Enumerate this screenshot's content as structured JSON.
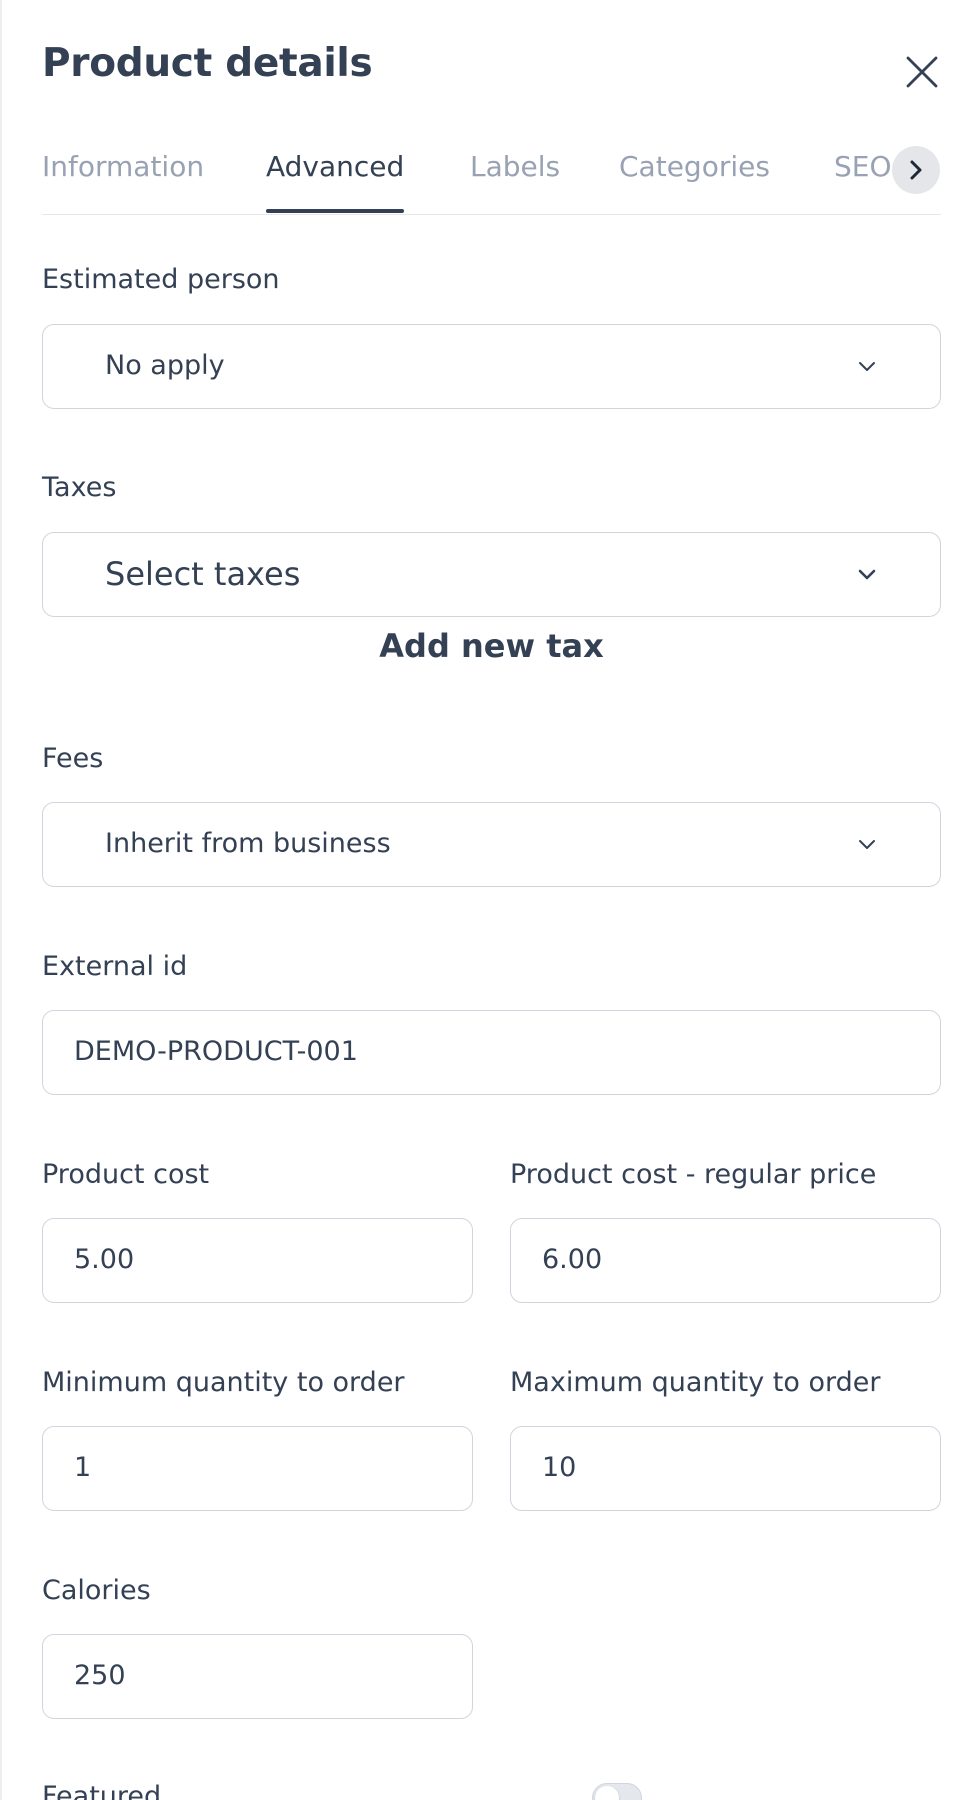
{
  "header": {
    "title": "Product details",
    "close_icon": "close-icon"
  },
  "tabs": [
    {
      "label": "Information",
      "active": false
    },
    {
      "label": "Advanced",
      "active": true
    },
    {
      "label": "Labels",
      "active": false
    },
    {
      "label": "Categories",
      "active": false
    },
    {
      "label": "SEO Options",
      "active": false
    }
  ],
  "tabs_next_icon": "chevron-right-icon",
  "form": {
    "estimated_person": {
      "label": "Estimated person",
      "value": "No apply"
    },
    "taxes": {
      "label": "Taxes",
      "placeholder": "Select taxes",
      "add_label": "Add new tax"
    },
    "fees": {
      "label": "Fees",
      "value": "Inherit from business"
    },
    "external_id": {
      "label": "External id",
      "value": "DEMO-PRODUCT-001"
    },
    "product_cost": {
      "label": "Product cost",
      "value": "5.00"
    },
    "product_cost_regular": {
      "label": "Product cost - regular price",
      "value": "6.00"
    },
    "min_quantity": {
      "label": "Minimum quantity to order",
      "value": "1"
    },
    "max_quantity": {
      "label": "Maximum quantity to order",
      "value": "10"
    },
    "calories": {
      "label": "Calories",
      "value": "250"
    },
    "featured": {
      "label": "Featured",
      "enabled": false
    }
  },
  "colors": {
    "text": "#344054",
    "muted": "#98a2b3",
    "border": "#d0d5dd"
  }
}
